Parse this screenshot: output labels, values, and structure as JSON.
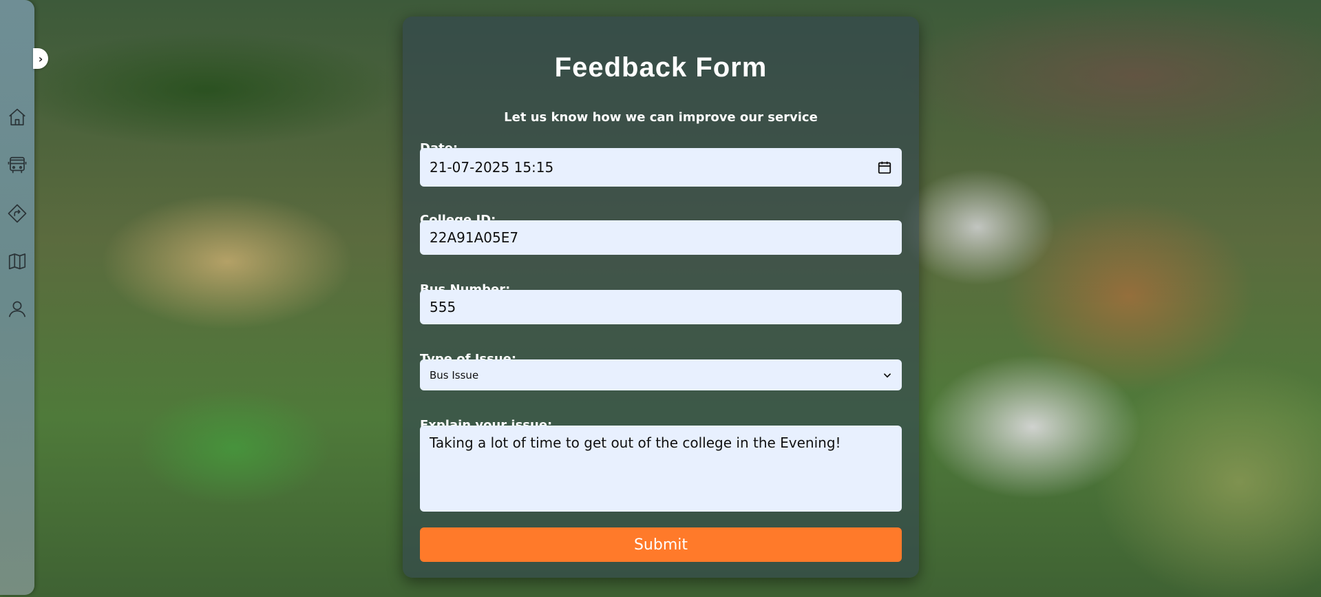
{
  "sidebar": {
    "toggle_icon": "chevron-right-icon",
    "items": [
      {
        "name": "home",
        "icon": "home-icon"
      },
      {
        "name": "bus",
        "icon": "bus-icon"
      },
      {
        "name": "route",
        "icon": "route-icon"
      },
      {
        "name": "map",
        "icon": "map-icon"
      },
      {
        "name": "profile",
        "icon": "user-icon"
      }
    ]
  },
  "form": {
    "title": "Feedback Form",
    "subtitle": "Let us know how we can improve our service",
    "fields": {
      "date": {
        "label": "Date:",
        "value": "21-07-2025 15:15",
        "icon": "calendar-icon"
      },
      "college_id": {
        "label": "College ID:",
        "value": "22A91A05E7"
      },
      "bus_number": {
        "label": "Bus Number:",
        "value": "555"
      },
      "issue_type": {
        "label": "Type of Issue:",
        "selected": "Bus Issue"
      },
      "issue_text": {
        "label": "Explain your issue:",
        "value": "Taking a lot of time to get out of the college in the Evening!"
      }
    },
    "submit_label": "Submit"
  },
  "colors": {
    "accent": "#ff7a2a",
    "field_bg": "#e8f0fe",
    "card_bg": "#32465099"
  }
}
